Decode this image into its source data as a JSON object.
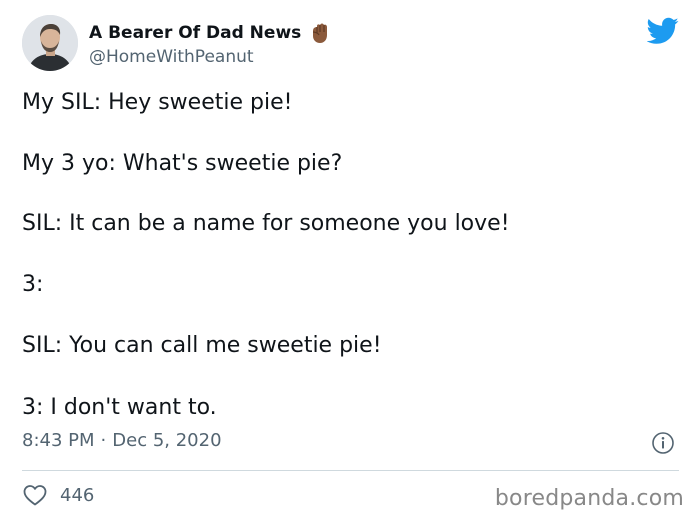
{
  "author": {
    "display_name": "A Bearer Of Dad News",
    "handle": "@HomeWithPeanut"
  },
  "tweet": {
    "lines": [
      "My SIL: Hey sweetie pie!",
      "My 3 yo: What's sweetie pie?",
      "SIL: It can be a name for someone you love!",
      "3:",
      "SIL: You can call me sweetie pie!",
      "3: I don't want to."
    ],
    "time": "8:43 PM",
    "separator": "·",
    "date": "Dec 5, 2020",
    "like_count": "446"
  },
  "watermark": "boredpanda.com",
  "colors": {
    "twitter_blue": "#1d9bf0",
    "text": "#0f1419",
    "secondary": "#536471",
    "divider": "#cfd9de"
  },
  "icons": [
    "twitter-bird-icon",
    "raised-fist-emoji-icon",
    "info-icon",
    "heart-icon"
  ]
}
